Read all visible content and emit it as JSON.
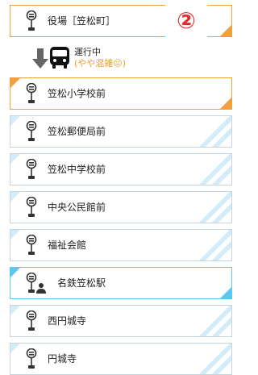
{
  "badge": "②",
  "current_stop": {
    "label": "役場［笠松町］"
  },
  "status": {
    "running": "運行中",
    "crowding": "(やや混雑😐)"
  },
  "stops": [
    {
      "label": "笠松小学校前",
      "style": "orange"
    },
    {
      "label": "笠松郵便局前",
      "style": "stripe"
    },
    {
      "label": "笠松中学校前",
      "style": "stripe"
    },
    {
      "label": "中央公民館前",
      "style": "stripe"
    },
    {
      "label": "福祉会館",
      "style": "stripe"
    },
    {
      "label": "名鉄笠松駅",
      "style": "blue"
    },
    {
      "label": "西円城寺",
      "style": "stripe"
    },
    {
      "label": "円城寺",
      "style": "stripe"
    }
  ],
  "colors": {
    "accent_orange": "#f0a040",
    "accent_blue": "#5ac8f0",
    "badge_red": "#e03030"
  },
  "icons": {
    "stop": "bus-stop-icon",
    "transfer": "transfer-stop-icon",
    "bus": "bus-icon",
    "arrow": "arrow-down-icon"
  }
}
